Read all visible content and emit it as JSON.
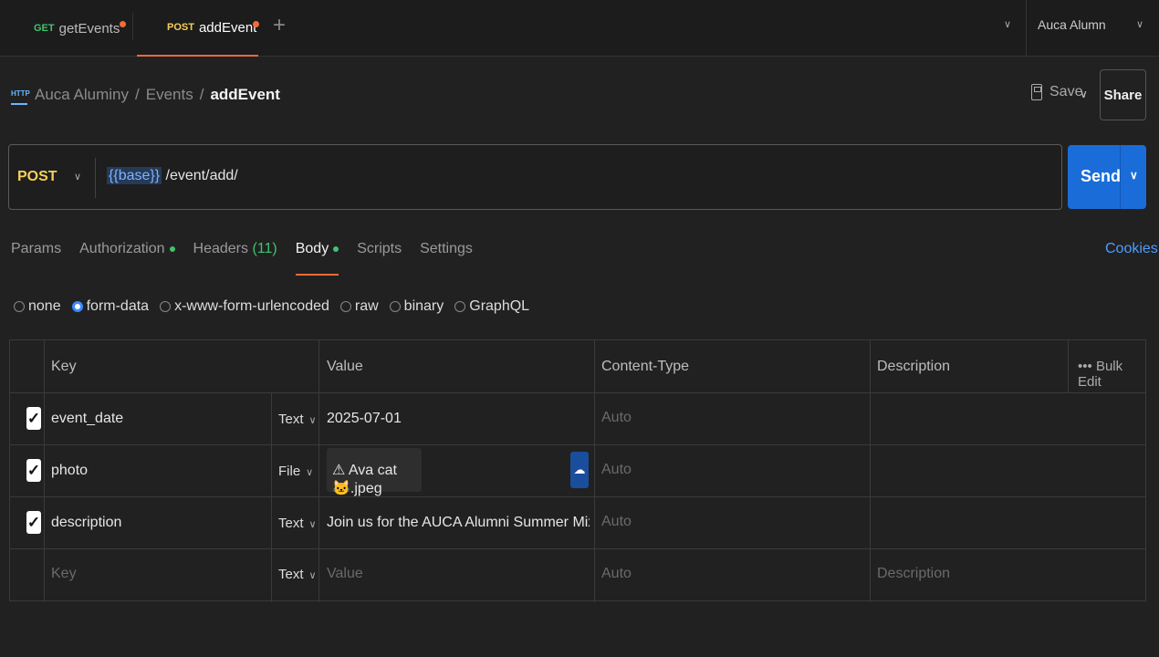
{
  "tabs": [
    {
      "method": "GET",
      "name": "getEvents",
      "method_color": "#3ec46d"
    },
    {
      "method": "POST",
      "name": "addEvent",
      "method_color": "#f6d05a"
    }
  ],
  "environment": "Auca Alumn",
  "breadcrumb": {
    "icon_text": "HTTP",
    "collection": "Auca Aluminy",
    "folder": "Events",
    "current": "addEvent"
  },
  "actions": {
    "save": "Save",
    "share": "Share"
  },
  "request": {
    "method": "POST",
    "url_var": "{{base}}",
    "url_path": "/event/add/",
    "send": "Send"
  },
  "request_tabs": {
    "params": "Params",
    "authorization": "Authorization",
    "headers": "Headers",
    "headers_count": "(11)",
    "body": "Body",
    "scripts": "Scripts",
    "settings": "Settings",
    "cookies": "Cookies"
  },
  "body_types": [
    "none",
    "form-data",
    "x-www-form-urlencoded",
    "raw",
    "binary",
    "GraphQL"
  ],
  "body_type_selected": "form-data",
  "table": {
    "headers": {
      "key": "Key",
      "value": "Value",
      "content_type": "Content-Type",
      "description": "Description",
      "bulk_edit": "Bulk Edit"
    },
    "rows": [
      {
        "checked": true,
        "key": "event_date",
        "type": "Text",
        "value": "2025-07-01",
        "content_type": "Auto",
        "description": ""
      },
      {
        "checked": true,
        "key": "photo",
        "type": "File",
        "value": "⚠ Ava cat 🐱.jpeg",
        "content_type": "Auto",
        "description": ""
      },
      {
        "checked": true,
        "key": "description",
        "type": "Text",
        "value": "Join us for the AUCA Alumni Summer Mixer with networki...",
        "content_type": "Auto",
        "description": ""
      }
    ],
    "placeholder_row": {
      "key": "Key",
      "type": "Text",
      "value": "Value",
      "content_type": "Auto",
      "description": "Description"
    }
  }
}
